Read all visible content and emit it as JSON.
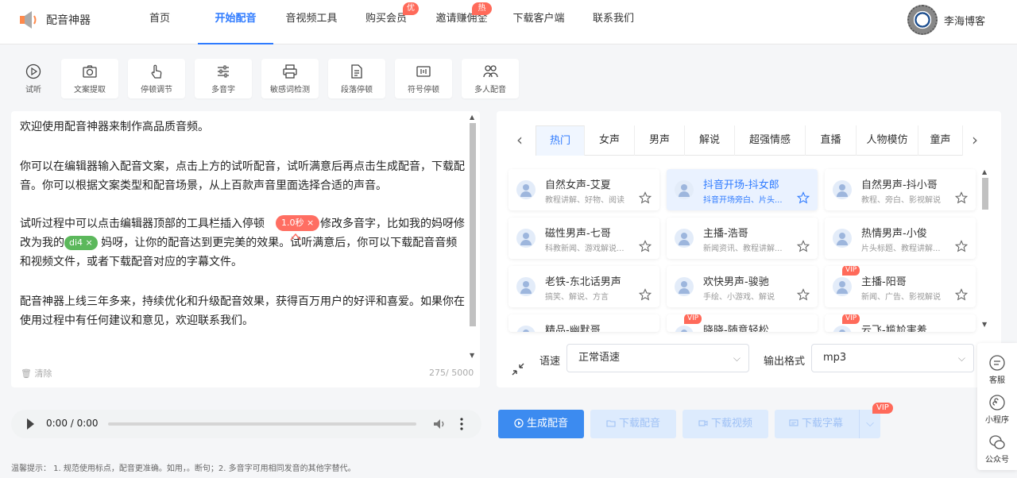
{
  "app": {
    "name": "配音神器",
    "accent": "#2f7bff"
  },
  "nav": {
    "items": [
      {
        "label": "首页"
      },
      {
        "label": "开始配音",
        "active": true
      },
      {
        "label": "音视频工具"
      },
      {
        "label": "购买会员",
        "badge": "优惠"
      },
      {
        "label": "邀请赚佣金",
        "badge": "热门"
      },
      {
        "label": "下载客户端"
      },
      {
        "label": "联系我们"
      }
    ]
  },
  "user": {
    "name": "李海博客"
  },
  "toolbar": {
    "items": [
      {
        "label": "试听",
        "icon": "play-circle-icon"
      },
      {
        "label": "文案提取",
        "icon": "camera-icon"
      },
      {
        "label": "停顿调节",
        "icon": "hand-icon"
      },
      {
        "label": "多音字",
        "icon": "sliders-icon"
      },
      {
        "label": "敏感词检测",
        "icon": "printer-icon"
      },
      {
        "label": "段落停顿",
        "icon": "document-icon"
      },
      {
        "label": "符号停顿",
        "icon": "bracket-icon"
      },
      {
        "label": "多人配音",
        "icon": "people-icon"
      }
    ]
  },
  "editor": {
    "p1": "欢迎使用配音神器来制作高品质音频。",
    "p2": "你可以在编辑器输入配音文案，点击上方的试听配音，试听满意后再点击生成配音，下载配音。你可以根据文案类型和配音场景，从上百款声音里面选择合适的声音。",
    "p3a": "试听过程中可以点击编辑器顶部的工具栏插入停顿",
    "p3b": "，修改多音字，比如我的妈呀修改为我的",
    "p3c": "妈呀，让你的配音达到更完美的效果。试听满意后，你可以下载配音音频和视频文件，或者下载配音对应的字幕文件。",
    "p4": "配音神器上线三年多来，持续优化和升级配音效果，获得百万用户的好评和喜爱。如果你在使用过程中有任何建议和意见，欢迎联系我们。",
    "pause_tag": "1.0秒 ×",
    "poly_tag": "di4 ×",
    "clear_label": "清除",
    "count": "275/ 5000"
  },
  "voice_tabs": [
    "热门",
    "女声",
    "男声",
    "解说",
    "超强情感",
    "直播",
    "人物模仿",
    "童声"
  ],
  "voices": [
    {
      "name": "自然女声-艾夏",
      "desc": "教程讲解、好物、阅读"
    },
    {
      "name": "抖音开场-抖女郎",
      "desc": "抖音开场旁白、片头...",
      "selected": true
    },
    {
      "name": "自然男声-抖小哥",
      "desc": "教程、旁白、影视解说"
    },
    {
      "name": "磁性男声-七哥",
      "desc": "科教新闻、游戏解说..."
    },
    {
      "name": "主播-浩哥",
      "desc": "新闻资讯、教程讲解..."
    },
    {
      "name": "热情男声-小俊",
      "desc": "片头标题、教程讲解..."
    },
    {
      "name": "老铁-东北话男声",
      "desc": "搞笑、解说、方言"
    },
    {
      "name": "欢快男声-骏驰",
      "desc": "手绘、小游戏、解说"
    },
    {
      "name": "主播-阳哥",
      "desc": "新闻、广告、影视解说",
      "vip": "VIP"
    },
    {
      "name": "精品-幽默哥",
      "desc": ""
    },
    {
      "name": "晓晓-随意轻松",
      "desc": "",
      "vip": "VIP"
    },
    {
      "name": "云飞-尴尬害羞",
      "desc": "",
      "vip": "VIP"
    }
  ],
  "options": {
    "speed_label": "语速",
    "speed_value": "正常语速",
    "format_label": "输出格式",
    "format_value": "mp3"
  },
  "player": {
    "time": "0:00 / 0:00"
  },
  "actions": {
    "generate": "生成配音",
    "download_audio": "下载配音",
    "download_video": "下载视频",
    "download_subtitle": "下载字幕",
    "vip": "VIP"
  },
  "side": {
    "service": "客服",
    "miniapp": "小程序",
    "official": "公众号"
  },
  "tip": "温馨提示： 1. 规范使用标点，配音更准确。如用，。断句；2. 多音字可用相同发音的其他字替代。"
}
